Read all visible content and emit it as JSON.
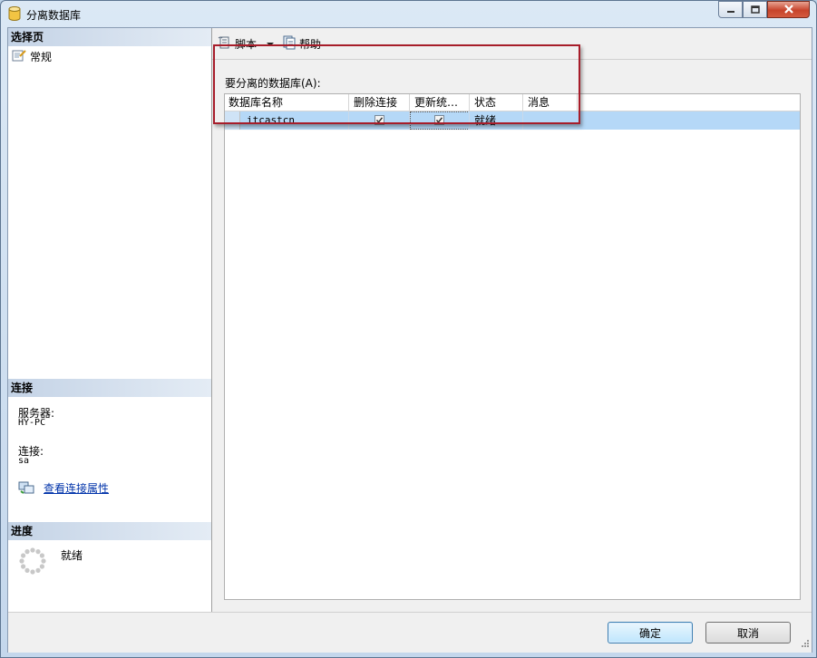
{
  "window": {
    "title": "分离数据库"
  },
  "left": {
    "select_page_header": "选择页",
    "nav_items": [
      {
        "label": "常规",
        "icon": "general-page-icon"
      }
    ],
    "connection_header": "连接",
    "server_label": "服务器:",
    "server_value": "HY-PC",
    "connection_label": "连接:",
    "connection_value": "sa",
    "view_properties_link": "查看连接属性",
    "progress_header": "进度",
    "progress_status": "就绪"
  },
  "toolbar": {
    "script_label": "脚本",
    "help_label": "帮助"
  },
  "main": {
    "grid_label": "要分离的数据库(A):",
    "columns": [
      "数据库名称",
      "删除连接",
      "更新统…",
      "状态",
      "消息"
    ],
    "rows": [
      {
        "database_name": "itcastcn",
        "drop_connections": true,
        "update_statistics": true,
        "status": "就绪",
        "message": ""
      }
    ]
  },
  "buttons": {
    "ok": "确定",
    "cancel": "取消"
  },
  "colors": {
    "highlight_border": "#a71d2a",
    "selected_row": "#b5d8f7"
  }
}
